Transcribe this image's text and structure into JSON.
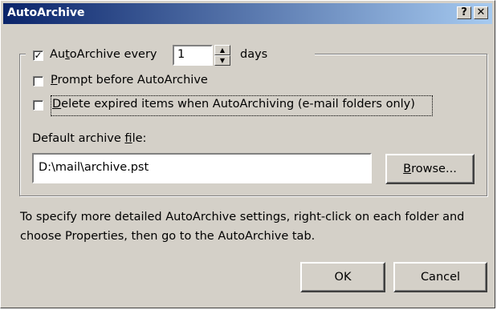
{
  "title": "AutoArchive",
  "title_buttons": {
    "help": "?",
    "close": "✕"
  },
  "autoarchive": {
    "checked": true,
    "check_mark": "✓",
    "label_pre": "Au",
    "label_u": "t",
    "label_post": "oArchive every",
    "days_value": "1",
    "days_label": "days",
    "spin_up": "▲",
    "spin_down": "▼"
  },
  "prompt": {
    "checked": false,
    "label_u": "P",
    "label_post": "rompt before AutoArchive"
  },
  "delete_expired": {
    "checked": false,
    "label_u": "D",
    "label_post": "elete expired items when AutoArchiving (e-mail folders only)"
  },
  "archive_file": {
    "label_pre": "Default archive ",
    "label_u": "f",
    "label_post": "ile:",
    "value": "D:\\mail\\archive.pst",
    "browse_u": "B",
    "browse_post": "rowse..."
  },
  "info_text": "To specify more detailed AutoArchive settings, right-click on each folder and choose Properties, then go to the AutoArchive tab.",
  "buttons": {
    "ok": "OK",
    "cancel": "Cancel"
  }
}
